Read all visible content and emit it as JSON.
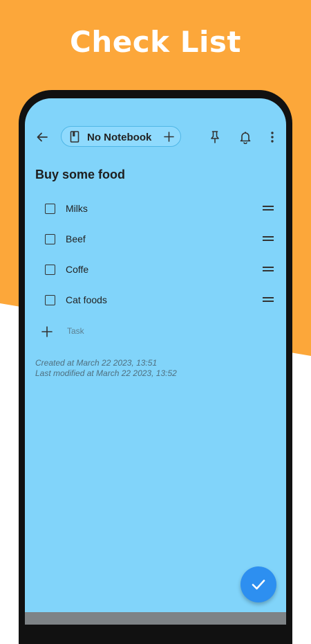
{
  "promo": {
    "title": "Check List"
  },
  "colors": {
    "accent": "#fca73a",
    "note_background": "#81d4fa",
    "fab": "#2d8ff0"
  },
  "toolbar": {
    "back_icon": "arrow-left-icon",
    "notebook_icon": "notebook-icon",
    "notebook_label": "No Notebook",
    "add_notebook_icon": "plus-icon",
    "pin_icon": "pin-icon",
    "reminder_icon": "bell-icon",
    "more_icon": "more-vertical-icon"
  },
  "note": {
    "title": "Buy some food",
    "tasks": [
      {
        "label": "Milks",
        "checked": false
      },
      {
        "label": "Beef",
        "checked": false
      },
      {
        "label": "Coffe",
        "checked": false
      },
      {
        "label": "Cat foods",
        "checked": false
      }
    ],
    "add_task_placeholder": "Task",
    "created": "Created at March 22 2023, 13:51",
    "modified": "Last modified at March 22 2023, 13:52"
  },
  "fab": {
    "icon": "check-icon"
  }
}
